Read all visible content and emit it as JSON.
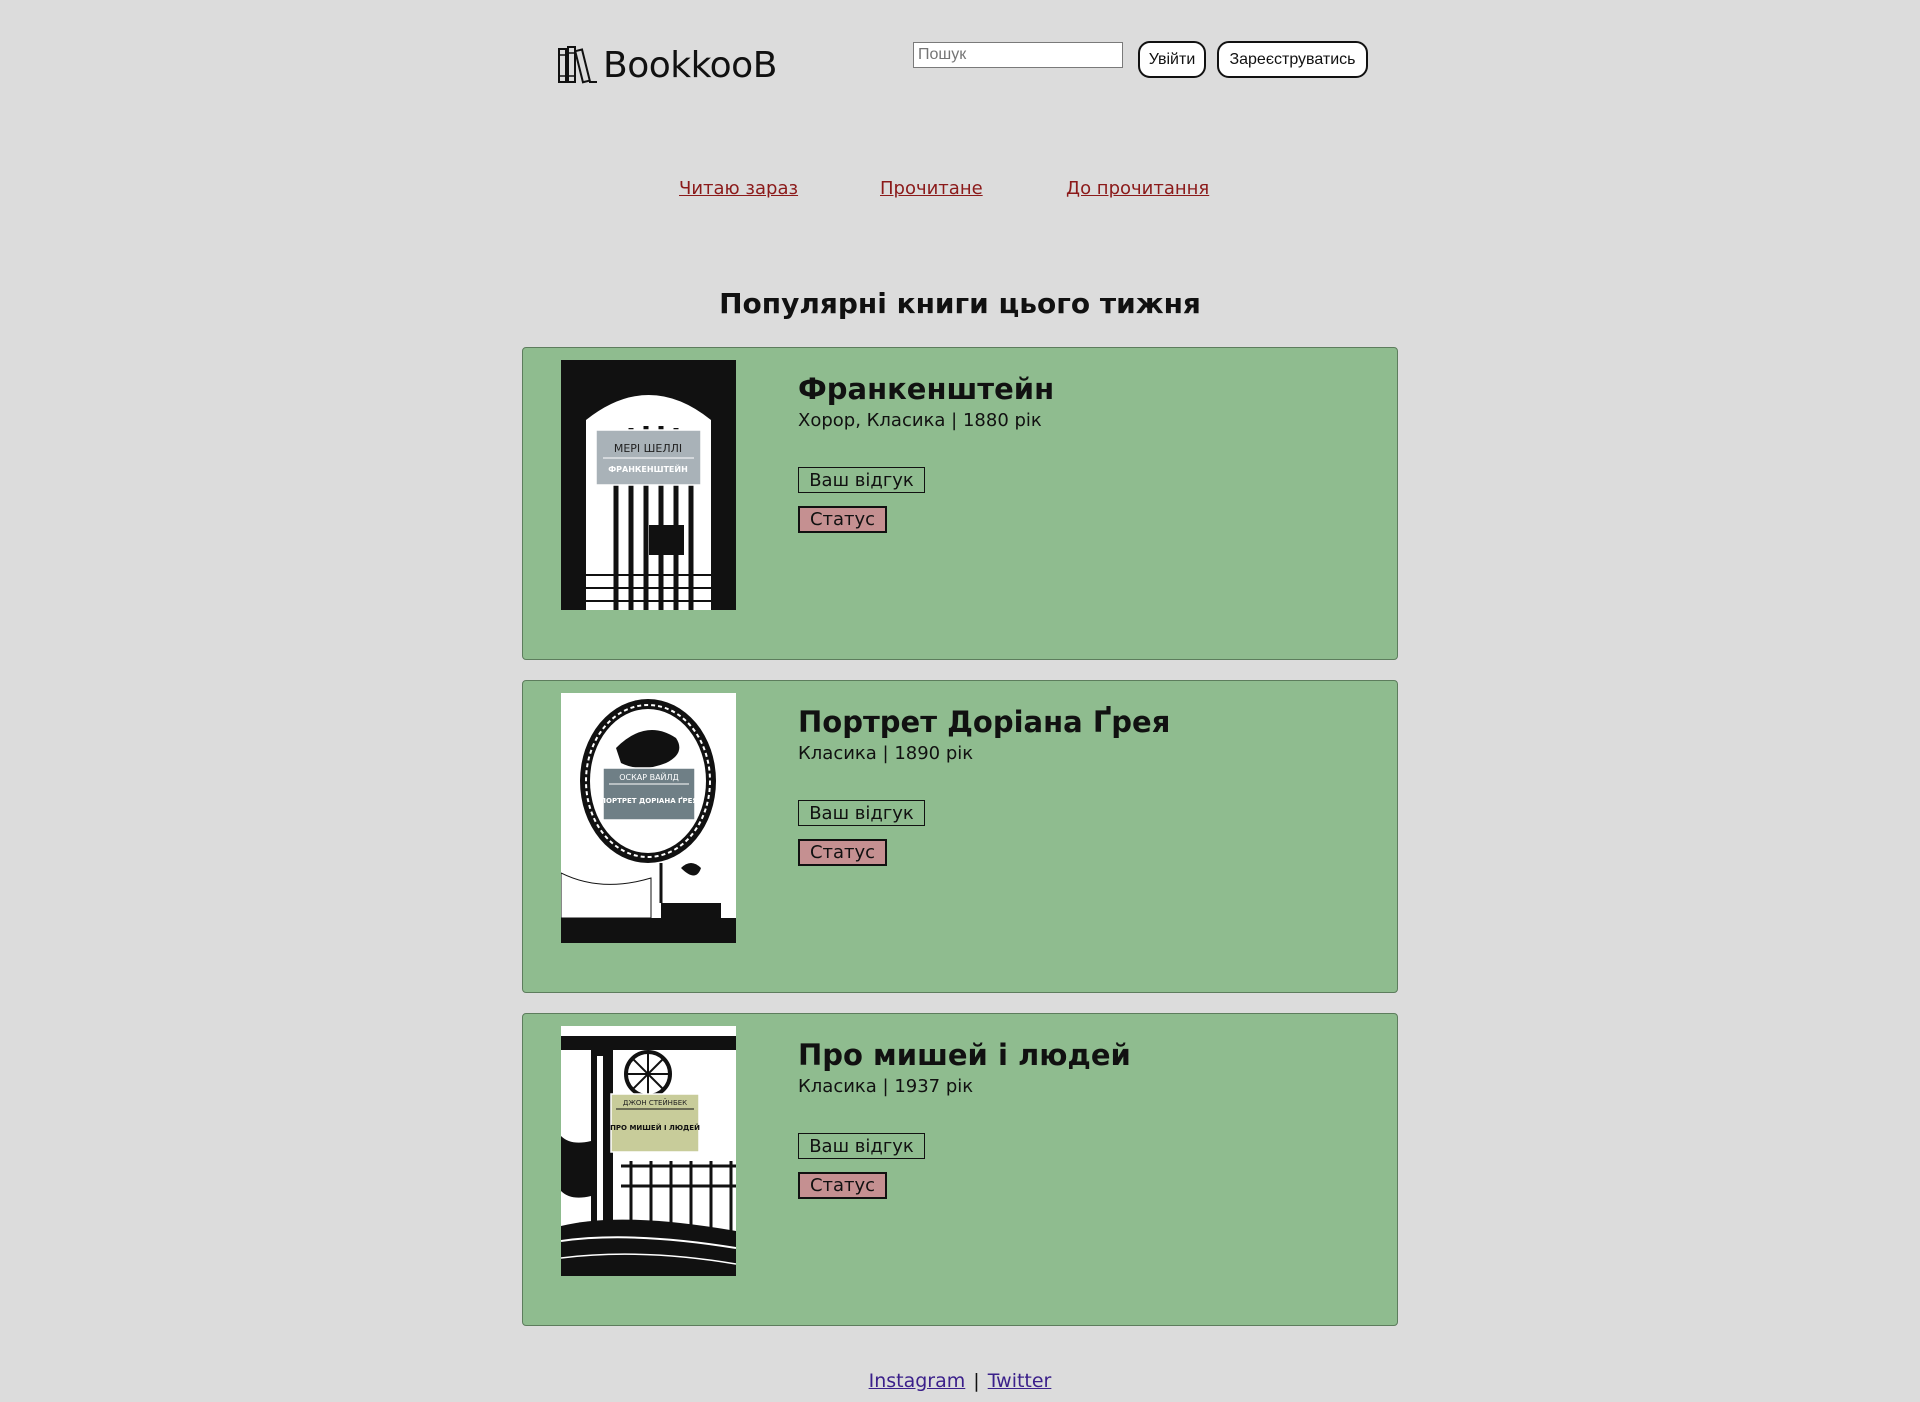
{
  "header": {
    "logo_text": "BookkooB",
    "logo_icon": "books-icon",
    "search_placeholder": "Пошук",
    "login_label": "Увійти",
    "signup_label": "Зареєструватись"
  },
  "nav": {
    "items": [
      {
        "label": "Читаю зараз"
      },
      {
        "label": "Прочитане"
      },
      {
        "label": "До прочитання"
      }
    ],
    "link_color": "#8b1a1a"
  },
  "main": {
    "section_title": "Популярні книги цього тижня",
    "card_color": "#8fbc8f",
    "status_color": "#c59091",
    "books": [
      {
        "title": "Франкенштейн",
        "meta": "Хорор, Класика | 1880 рік",
        "review_label": "Ваш відгук",
        "status_label": "Статус",
        "cover_author": "МЕРІ ШЕЛЛІ",
        "cover_title": "ФРАНКЕНШТЕЙН"
      },
      {
        "title": "Портрет Доріана Ґрея",
        "meta": "Класика | 1890 рік",
        "review_label": "Ваш відгук",
        "status_label": "Статус",
        "cover_author": "ОСКАР ВАЙЛД",
        "cover_title": "ПОРТРЕТ ДОРІАНА ҐРЕЯ"
      },
      {
        "title": "Про мишей і людей",
        "meta": "Класика | 1937 рік",
        "review_label": "Ваш відгук",
        "status_label": "Статус",
        "cover_author": "ДЖОН СТЕЙНБЕК",
        "cover_title": "ПРО МИШЕЙ І ЛЮДЕЙ"
      }
    ]
  },
  "footer": {
    "instagram": "Instagram",
    "separator": "|",
    "twitter": "Twitter"
  }
}
